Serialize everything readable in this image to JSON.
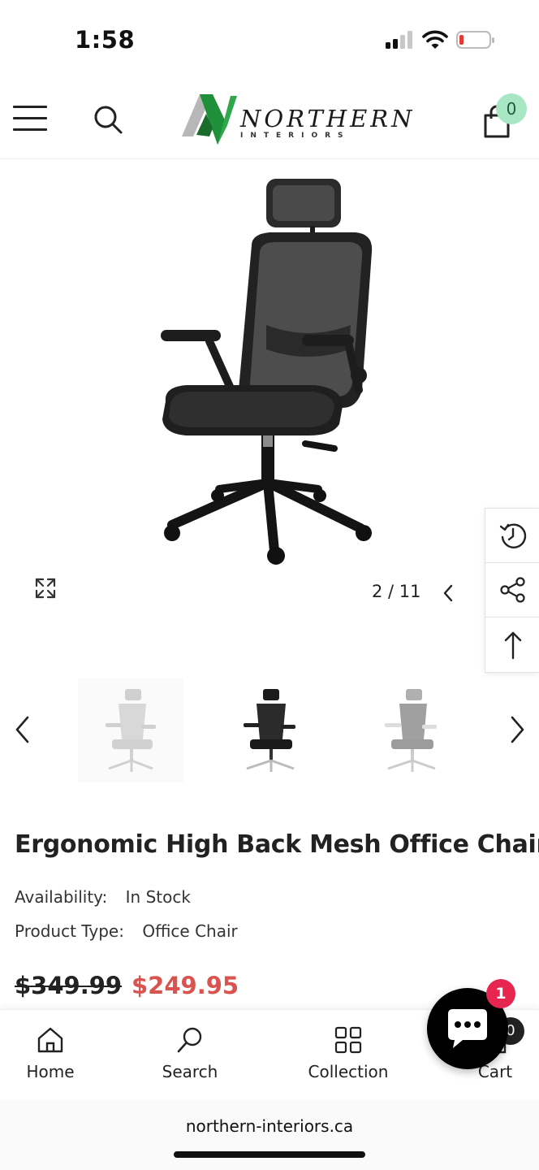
{
  "status_bar": {
    "time": "1:58"
  },
  "header": {
    "logo_word": "NORTHERN",
    "logo_sub": "INTERIORS",
    "cart_count": "0",
    "icons": [
      "menu-icon",
      "search-icon",
      "shopping-bag-icon"
    ],
    "accent_color": "#a8e6c4"
  },
  "gallery": {
    "counter": "2 / 11",
    "tools": [
      "history-icon",
      "share-icon",
      "arrow-up-icon"
    ]
  },
  "product": {
    "title": "Ergonomic High Back Mesh Office Chair",
    "availability_label": "Availability:",
    "availability_value": "In Stock",
    "type_label": "Product Type:",
    "type_value": "Office Chair",
    "price_old": "$349.99",
    "price_new": "$249.95",
    "sale_color": "#d9534f"
  },
  "bottom_nav": {
    "items": [
      {
        "label": "Home",
        "icon": "home-icon"
      },
      {
        "label": "Search",
        "icon": "search-icon"
      },
      {
        "label": "Collection",
        "icon": "grid-icon"
      },
      {
        "label": "Cart",
        "icon": "cart-icon"
      }
    ],
    "cart_count": "0"
  },
  "chat": {
    "badge": "1"
  },
  "browser": {
    "url": "northern-interiors.ca"
  }
}
